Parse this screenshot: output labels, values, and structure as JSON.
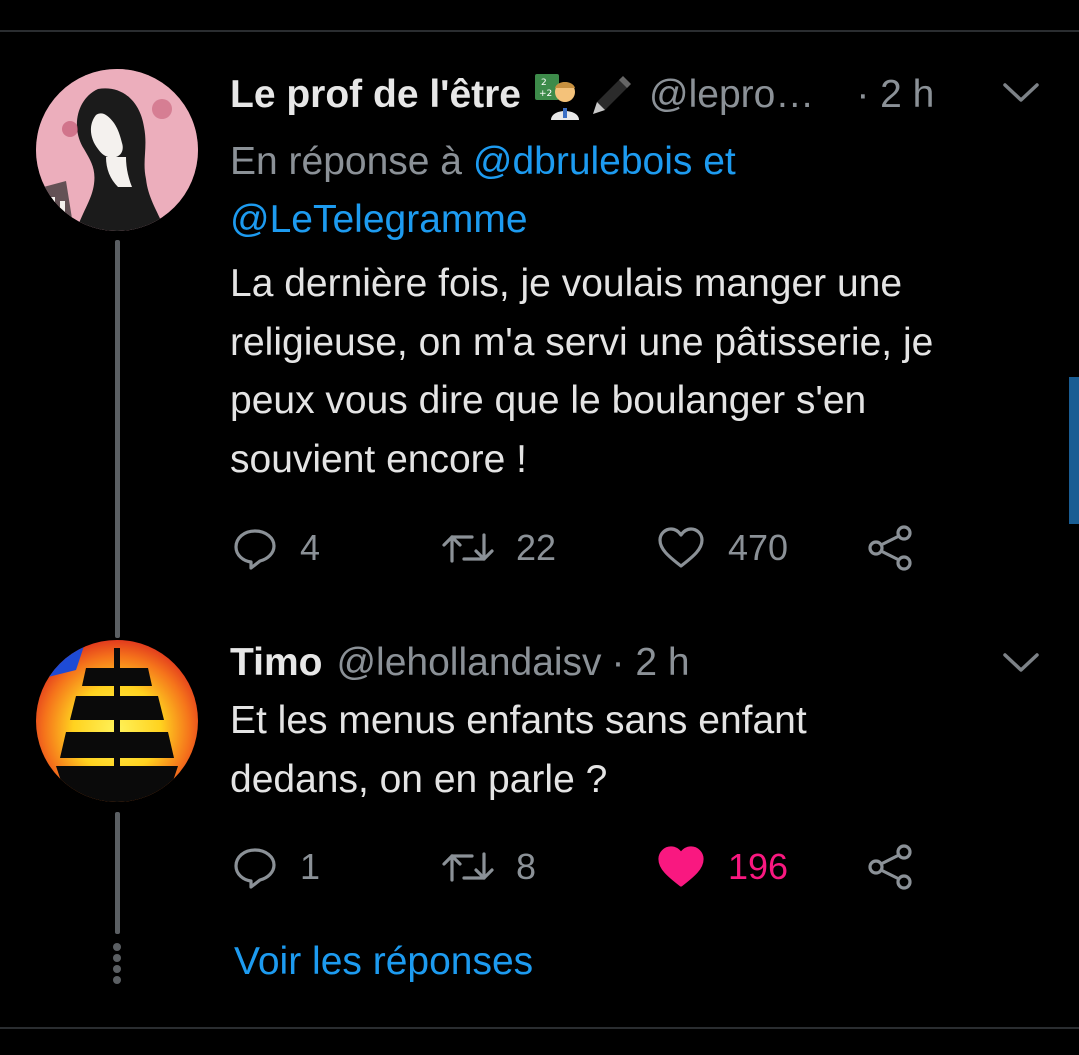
{
  "tweets": [
    {
      "name": "Le prof de l'être",
      "handle": "@lepro…",
      "time": "· 2 h",
      "emoji": [
        "teacher-emoji",
        "pen-emoji"
      ],
      "reply_prefix": "En réponse à",
      "reply_mention_1": "@dbrulebois et",
      "reply_mention_2": "@LeTelegramme",
      "text": [
        "La dernière fois, je voulais manger une",
        "religieuse, on m'a servi une pâtisserie, je",
        "peux vous dire que le boulanger s'en",
        "souvient encore !"
      ],
      "replies": "4",
      "retweets": "22",
      "likes": "470",
      "liked": false
    },
    {
      "name": "Timo",
      "handle": "@lehollandaisv",
      "time": "· 2 h",
      "text": [
        "Et les menus enfants sans enfant",
        "dedans, on en parle ?"
      ],
      "replies": "1",
      "retweets": "8",
      "likes": "196",
      "liked": true
    }
  ],
  "see_replies": "Voir les réponses",
  "icons": {
    "reply": "reply-icon",
    "retweet": "retweet-icon",
    "like": "heart-icon",
    "share": "share-icon",
    "more": "chevron-down-icon"
  },
  "colors": {
    "background": "#000000",
    "link": "#1d9bf0",
    "like_active": "#f91880",
    "muted": "#8b9197"
  }
}
